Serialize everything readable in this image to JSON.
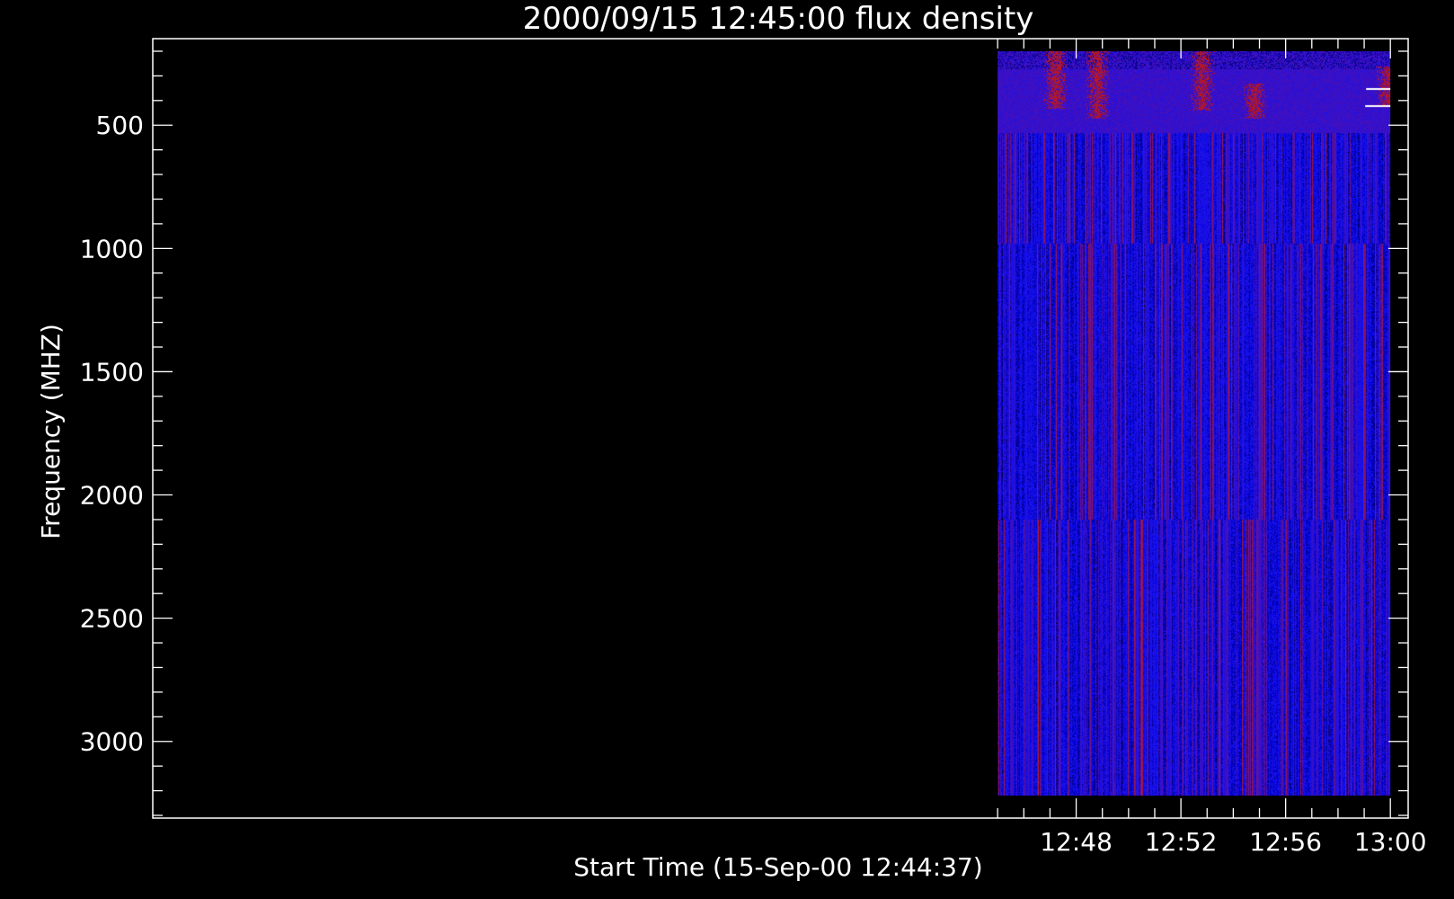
{
  "chart_data": {
    "type": "heatmap",
    "title": "2000/09/15 12:45:00 flux density",
    "xlabel": "Start Time (15-Sep-00 12:44:37)",
    "ylabel": "Frequency (MHZ)",
    "x_major_ticks": [
      "12:48",
      "12:52",
      "12:56",
      "13:00"
    ],
    "y_major_ticks": [
      500,
      1000,
      1500,
      2000,
      2500,
      3000
    ],
    "xlim_minutes": [
      12.73,
      60.68
    ],
    "ylim_mhz": [
      149,
      3311
    ],
    "data_time_range_minutes": [
      45.0,
      60.0
    ],
    "data_freq_range_mhz": [
      200,
      3220
    ],
    "band_edges_mhz": [
      530,
      980,
      2100
    ],
    "y_reversed": true,
    "colormap": [
      "#000033",
      "#1010f0",
      "#c01818",
      "#ffffff"
    ],
    "background_value_color": "#1010f0",
    "grid": false,
    "legend": "none",
    "bursts": [
      {
        "time_min": 47.2,
        "freq_top_mhz": 200,
        "freq_bottom_mhz": 430
      },
      {
        "time_min": 48.8,
        "freq_top_mhz": 200,
        "freq_bottom_mhz": 470
      },
      {
        "time_min": 52.8,
        "freq_top_mhz": 200,
        "freq_bottom_mhz": 440
      },
      {
        "time_min": 54.8,
        "freq_top_mhz": 330,
        "freq_bottom_mhz": 470
      },
      {
        "time_min": 59.9,
        "freq_top_mhz": 260,
        "freq_bottom_mhz": 420
      }
    ]
  }
}
